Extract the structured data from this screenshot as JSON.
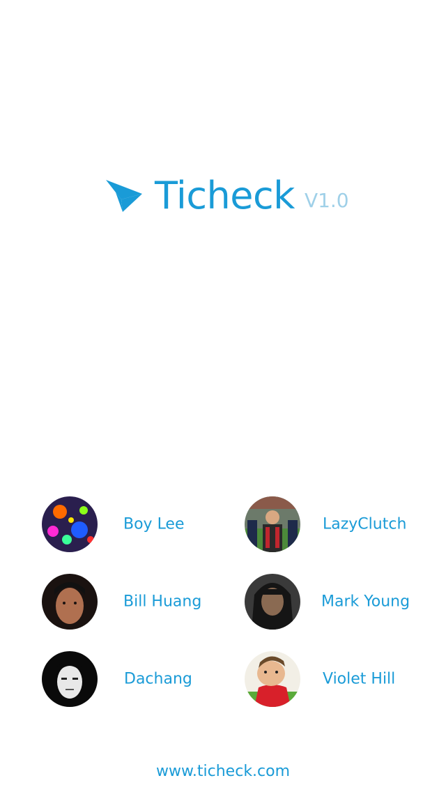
{
  "app": {
    "name": "Ticheck",
    "version": "V1.0",
    "brand_color": "#1a9bd7",
    "version_color": "#9fd0e8",
    "logo_icon": "paper-plane-icon"
  },
  "team": {
    "members": [
      {
        "name": "Boy Lee"
      },
      {
        "name": "LazyClutch"
      },
      {
        "name": "Bill Huang"
      },
      {
        "name": "Mark Young"
      },
      {
        "name": "Dachang"
      },
      {
        "name": "Violet Hill"
      }
    ]
  },
  "footer": {
    "website": "www.ticheck.com"
  }
}
